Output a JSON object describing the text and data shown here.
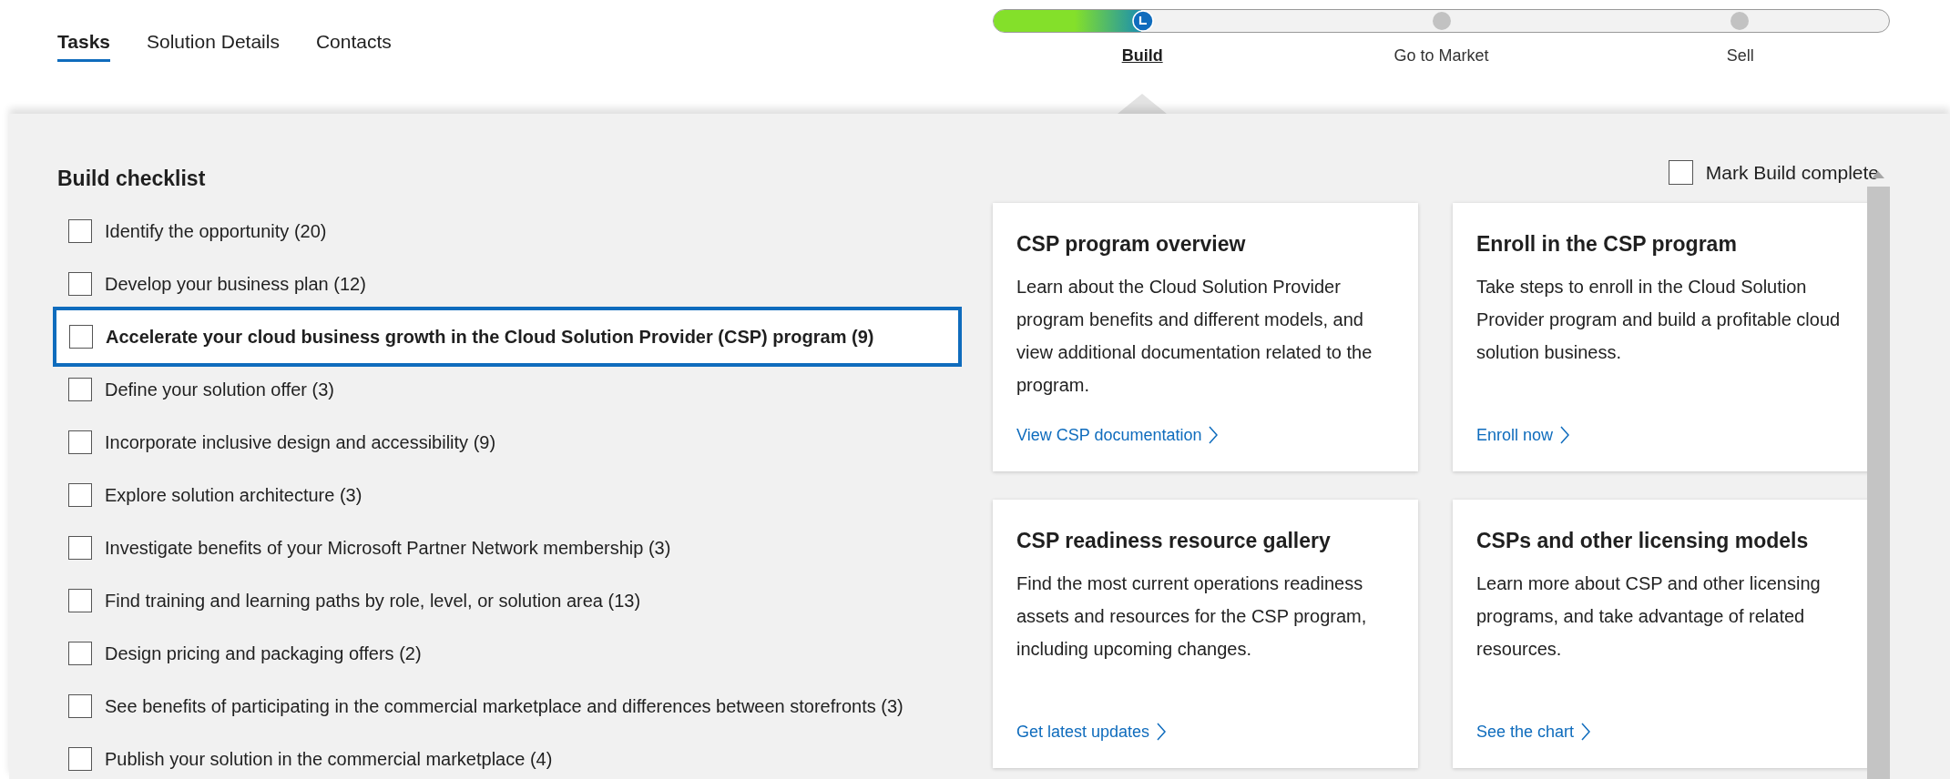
{
  "tabs": [
    {
      "label": "Tasks",
      "selected": true
    },
    {
      "label": "Solution Details",
      "selected": false
    },
    {
      "label": "Contacts",
      "selected": false
    }
  ],
  "progress": {
    "level": 0.165,
    "stages": [
      {
        "label": "Build",
        "selected": true
      },
      {
        "label": "Go to Market",
        "selected": false
      },
      {
        "label": "Sell",
        "selected": false
      }
    ]
  },
  "checklist": {
    "title": "Build checklist",
    "mark_complete": {
      "label": "Mark Build complete",
      "checked": false
    },
    "items": [
      {
        "label": "Identify the opportunity (20)",
        "checked": false,
        "selected": false
      },
      {
        "label": "Develop your business plan (12)",
        "checked": false,
        "selected": false
      },
      {
        "label": "Accelerate your cloud business growth in the Cloud Solution Provider (CSP) program (9)",
        "checked": false,
        "selected": true
      },
      {
        "label": "Define your solution offer (3)",
        "checked": false,
        "selected": false
      },
      {
        "label": "Incorporate inclusive design and accessibility (9)",
        "checked": false,
        "selected": false
      },
      {
        "label": "Explore solution architecture (3)",
        "checked": false,
        "selected": false
      },
      {
        "label": "Investigate benefits of your Microsoft Partner Network membership (3)",
        "checked": false,
        "selected": false
      },
      {
        "label": "Find training and learning paths by role, level, or solution area (13)",
        "checked": false,
        "selected": false
      },
      {
        "label": "Design pricing and packaging offers (2)",
        "checked": false,
        "selected": false
      },
      {
        "label": "See benefits of participating in the commercial marketplace and differences between storefronts (3)",
        "checked": false,
        "selected": false
      },
      {
        "label": "Publish your solution in the commercial marketplace (4)",
        "checked": false,
        "selected": false
      }
    ]
  },
  "cards": [
    {
      "title": "CSP program overview",
      "body": "Learn about the Cloud Solution Provider program benefits and different models, and view additional documentation related to the program.",
      "link": "View CSP documentation"
    },
    {
      "title": "Enroll in the CSP program",
      "body": "Take steps to enroll in the Cloud Solution Provider program and build a profitable cloud solution business.",
      "link": "Enroll now"
    },
    {
      "title": "CSP readiness resource gallery",
      "body": "Find the most current operations readiness assets and resources for the CSP program, including upcoming changes.",
      "link": "Get latest updates"
    },
    {
      "title": "CSPs and other licensing models",
      "body": "Learn more about CSP and other licensing programs, and take advantage of related resources.",
      "link": "See the chart"
    }
  ]
}
